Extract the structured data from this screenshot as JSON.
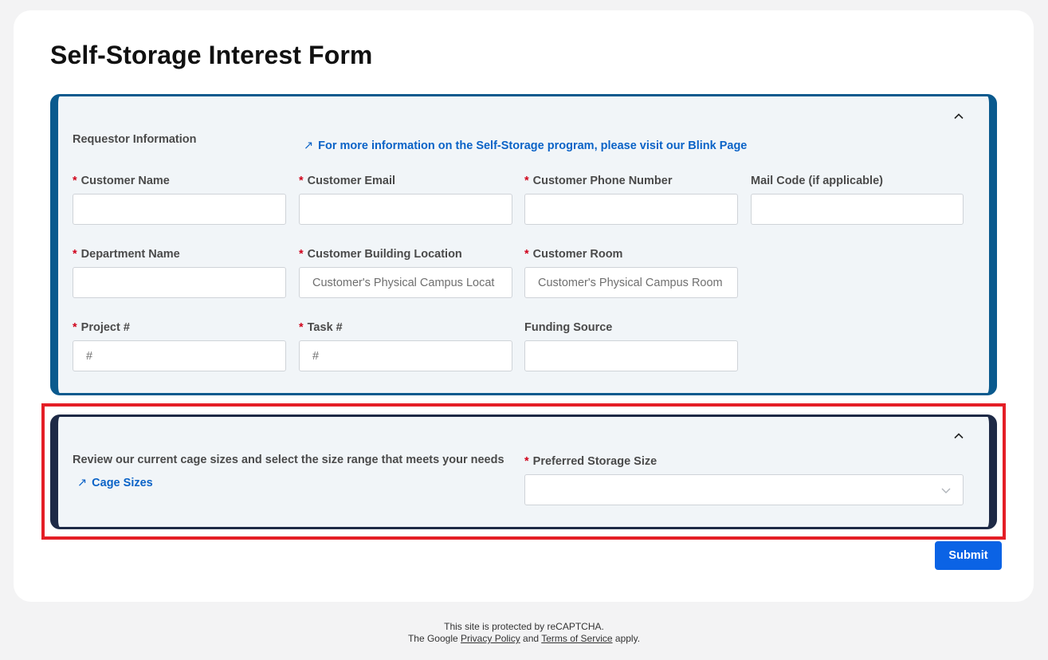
{
  "page": {
    "title": "Self-Storage Interest Form"
  },
  "requestor": {
    "section_label": "Requestor Information",
    "info_link": "For more information on the Self-Storage program, please visit our Blink Page",
    "fields": {
      "customer_name": {
        "label": "Customer Name",
        "value": "",
        "placeholder": ""
      },
      "customer_email": {
        "label": "Customer Email",
        "value": "",
        "placeholder": ""
      },
      "customer_phone": {
        "label": "Customer Phone Number",
        "value": "",
        "placeholder": ""
      },
      "mail_code": {
        "label": "Mail Code (if applicable)",
        "value": "",
        "placeholder": ""
      },
      "department_name": {
        "label": "Department Name",
        "value": "",
        "placeholder": ""
      },
      "building_location": {
        "label": "Customer Building Location",
        "value": "",
        "placeholder": "Customer's Physical Campus Locat"
      },
      "customer_room": {
        "label": "Customer Room",
        "value": "",
        "placeholder": "Customer's Physical Campus Room"
      },
      "project": {
        "label": "Project #",
        "value": "",
        "placeholder": "#"
      },
      "task": {
        "label": "Task #",
        "value": "",
        "placeholder": "#"
      },
      "funding_source": {
        "label": "Funding Source",
        "value": "",
        "placeholder": ""
      }
    },
    "required_marker": "*"
  },
  "storage": {
    "section_label": "Review our current cage sizes and select the size range that meets your needs",
    "cage_link": "Cage Sizes",
    "preferred_size": {
      "label": "Preferred Storage Size",
      "selected": ""
    }
  },
  "actions": {
    "submit_label": "Submit"
  },
  "footer": {
    "line1": "This site is protected by reCAPTCHA.",
    "prefix": "The Google",
    "privacy": "Privacy Policy",
    "and": "and",
    "terms": "Terms of Service",
    "suffix": "apply."
  },
  "colors": {
    "section1_border": "#0a5a8e",
    "section2_border": "#1e2a46",
    "highlight": "#e41e26",
    "link": "#0b63c7",
    "submit": "#0b63e5",
    "required": "#d0021b"
  },
  "icons": {
    "collapse": "chevron-up-icon",
    "external_link": "arrow-up-right-icon",
    "dropdown": "chevron-down-icon"
  }
}
